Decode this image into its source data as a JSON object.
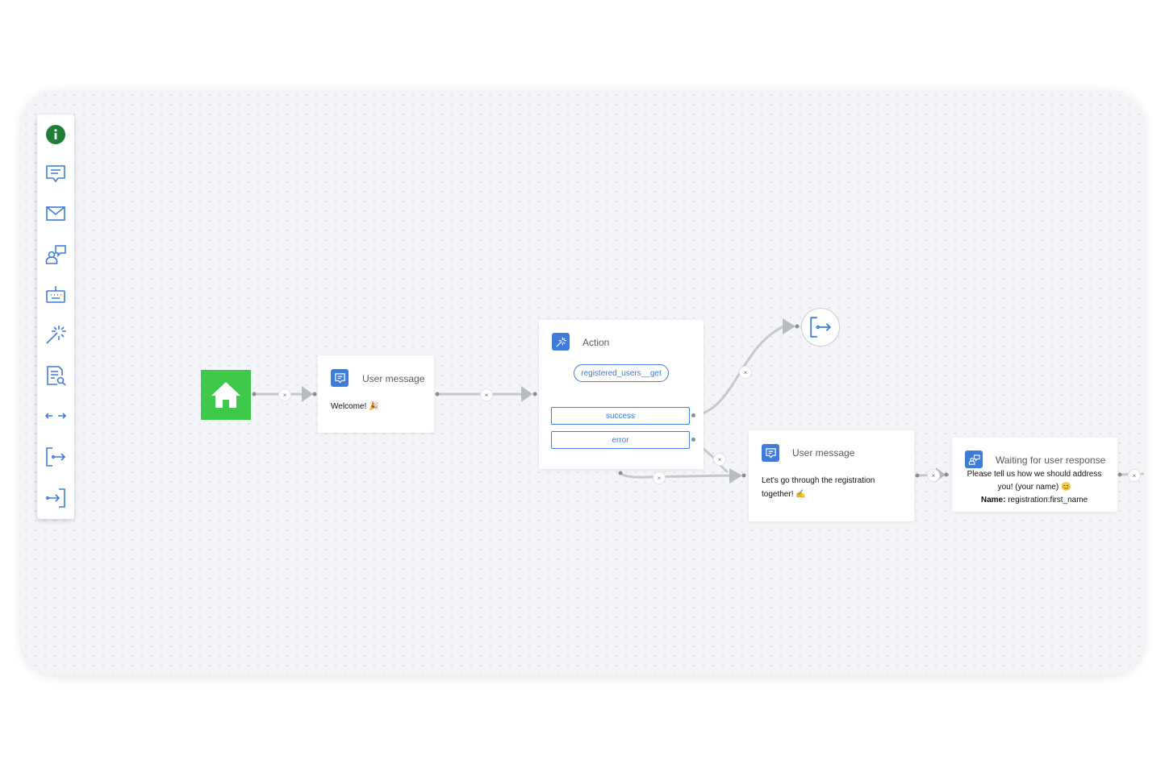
{
  "toolbar": {
    "tools": [
      {
        "name": "info-icon",
        "color": "#1e7e34"
      },
      {
        "name": "message-icon",
        "color": "#3f7bd9"
      },
      {
        "name": "mail-icon",
        "color": "#3f7bd9"
      },
      {
        "name": "wait-user-response-icon",
        "color": "#3f7bd9"
      },
      {
        "name": "keyboard-icon",
        "color": "#3f7bd9"
      },
      {
        "name": "action-wand-icon",
        "color": "#3f7bd9"
      },
      {
        "name": "document-search-icon",
        "color": "#3f7bd9"
      },
      {
        "name": "redirect-arrows-icon",
        "color": "#3f7bd9"
      },
      {
        "name": "exit-icon",
        "color": "#3f7bd9"
      },
      {
        "name": "enter-icon",
        "color": "#3f7bd9"
      }
    ]
  },
  "nodes": {
    "start": {
      "icon": "home-icon",
      "color": "#3ec94a"
    },
    "welcome": {
      "title": "User message",
      "text": "Welcome! 🎉"
    },
    "action": {
      "title": "Action",
      "pill": "registered_users__get",
      "outputs": [
        "success",
        "error"
      ]
    },
    "registration": {
      "title": "User message",
      "text": "Let's go through the registration together! ✍"
    },
    "waiting": {
      "title": "Waiting for user response",
      "text": "Please tell us how we should address you! (your name) 😊",
      "field_label": "Name:",
      "field_value": "registration:first_name"
    },
    "exit": {
      "icon": "exit-icon"
    }
  },
  "edges": {
    "remove_label": "×"
  },
  "colors": {
    "accent": "#3f7bd9",
    "start": "#3ec94a",
    "edge": "#c6c8cd",
    "info": "#1e7e34"
  }
}
